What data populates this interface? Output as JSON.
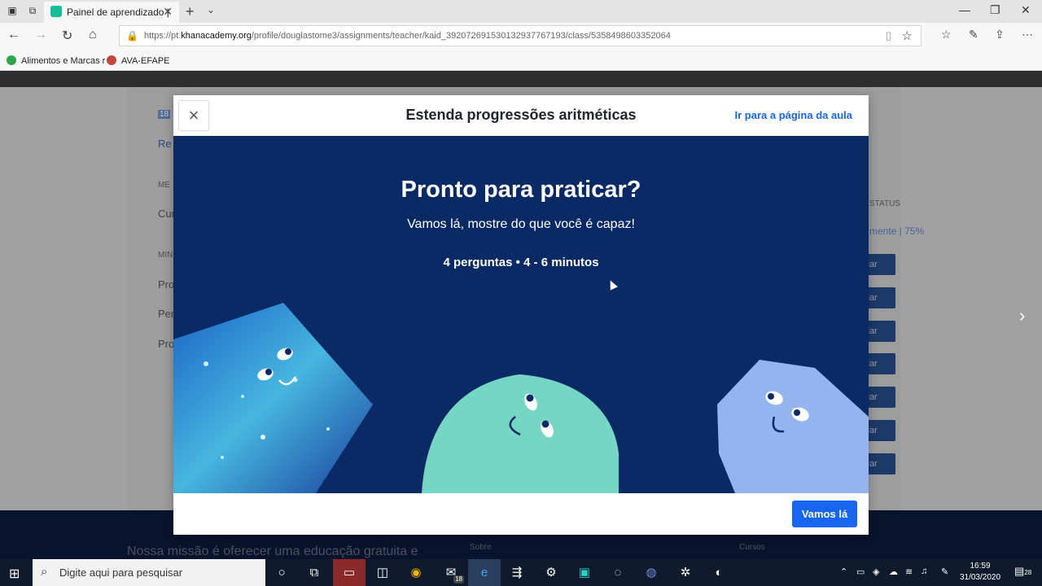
{
  "browser": {
    "tab_title": "Painel de aprendizado |",
    "url_prefix": "https://pt.",
    "url_domain": "khanacademy.org",
    "url_path": "/profile/douglastome3/assignments/teacher/kaid_392072691530132937767193/class/5358498603352064",
    "bookmarks": [
      "Alimentos e Marcas r",
      "AVA-EFAPE"
    ]
  },
  "background_page": {
    "left_texts": [
      "Re",
      "ME",
      "Cur",
      "MIN",
      "Pro",
      "Per",
      "Pro"
    ],
    "badge": "18",
    "status_header": "STATUS",
    "status_value": "mente | 75%",
    "row_button": "ciar",
    "footer_mission": "Nossa missão é oferecer uma educação gratuita e",
    "footer_about": "Sobre",
    "footer_courses": "Cursos"
  },
  "modal": {
    "title": "Estenda progressões aritméticas",
    "lesson_link": "Ir para a página da aula",
    "heading": "Pronto para praticar?",
    "subheading": "Vamos lá, mostre do que você é capaz!",
    "meta": "4 perguntas • 4 - 6 minutos",
    "start_button": "Vamos lá"
  },
  "taskbar": {
    "search_placeholder": "Digite aqui para pesquisar",
    "mail_badge": "18",
    "time": "16:59",
    "date": "31/03/2020",
    "notifications": "28"
  }
}
